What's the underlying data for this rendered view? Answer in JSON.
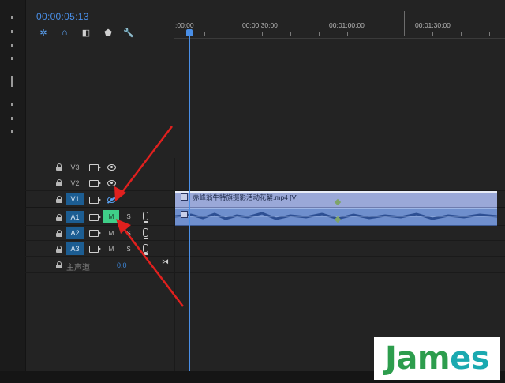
{
  "timecode": "00:00:05:13",
  "toolbar": [
    {
      "icon": "ripple-insert-icon",
      "glyph": "✲",
      "active": true
    },
    {
      "icon": "snap-magnet-icon",
      "glyph": "∩",
      "active": true
    },
    {
      "icon": "linked-selection-icon",
      "glyph": "◧",
      "active": false
    },
    {
      "icon": "add-marker-icon",
      "glyph": "⬟",
      "active": false
    },
    {
      "icon": "wrench-settings-icon",
      "glyph": "🔧",
      "active": false
    }
  ],
  "ruler": [
    ":00:00",
    "00:00:30:00",
    "00:01:00:00",
    "00:01:30:00"
  ],
  "tracks": {
    "v3": {
      "name": "V3"
    },
    "v2": {
      "name": "V2"
    },
    "v1": {
      "name": "V1"
    },
    "a1": {
      "name": "A1",
      "mute": "M",
      "solo": "S"
    },
    "a2": {
      "name": "A2",
      "mute": "M",
      "solo": "S"
    },
    "a3": {
      "name": "A3",
      "mute": "M",
      "solo": "S"
    }
  },
  "master": {
    "label": "主声道",
    "value": "0.0",
    "end_icon": "⧒"
  },
  "video_clip": {
    "label": "赤峰翁牛特旗摄影活动花絮.mp4 [V]"
  },
  "watermark": {
    "text_1": "Jam",
    "text_2": "es"
  },
  "colors": {
    "accent_blue": "#4a8fe7",
    "selected_track": "#1c5d92",
    "mute_on": "#3fcf88",
    "video_clip": "#9aa8d8",
    "audio_clip": "#6f8fcd",
    "annotation_arrow": "#e0201e"
  }
}
